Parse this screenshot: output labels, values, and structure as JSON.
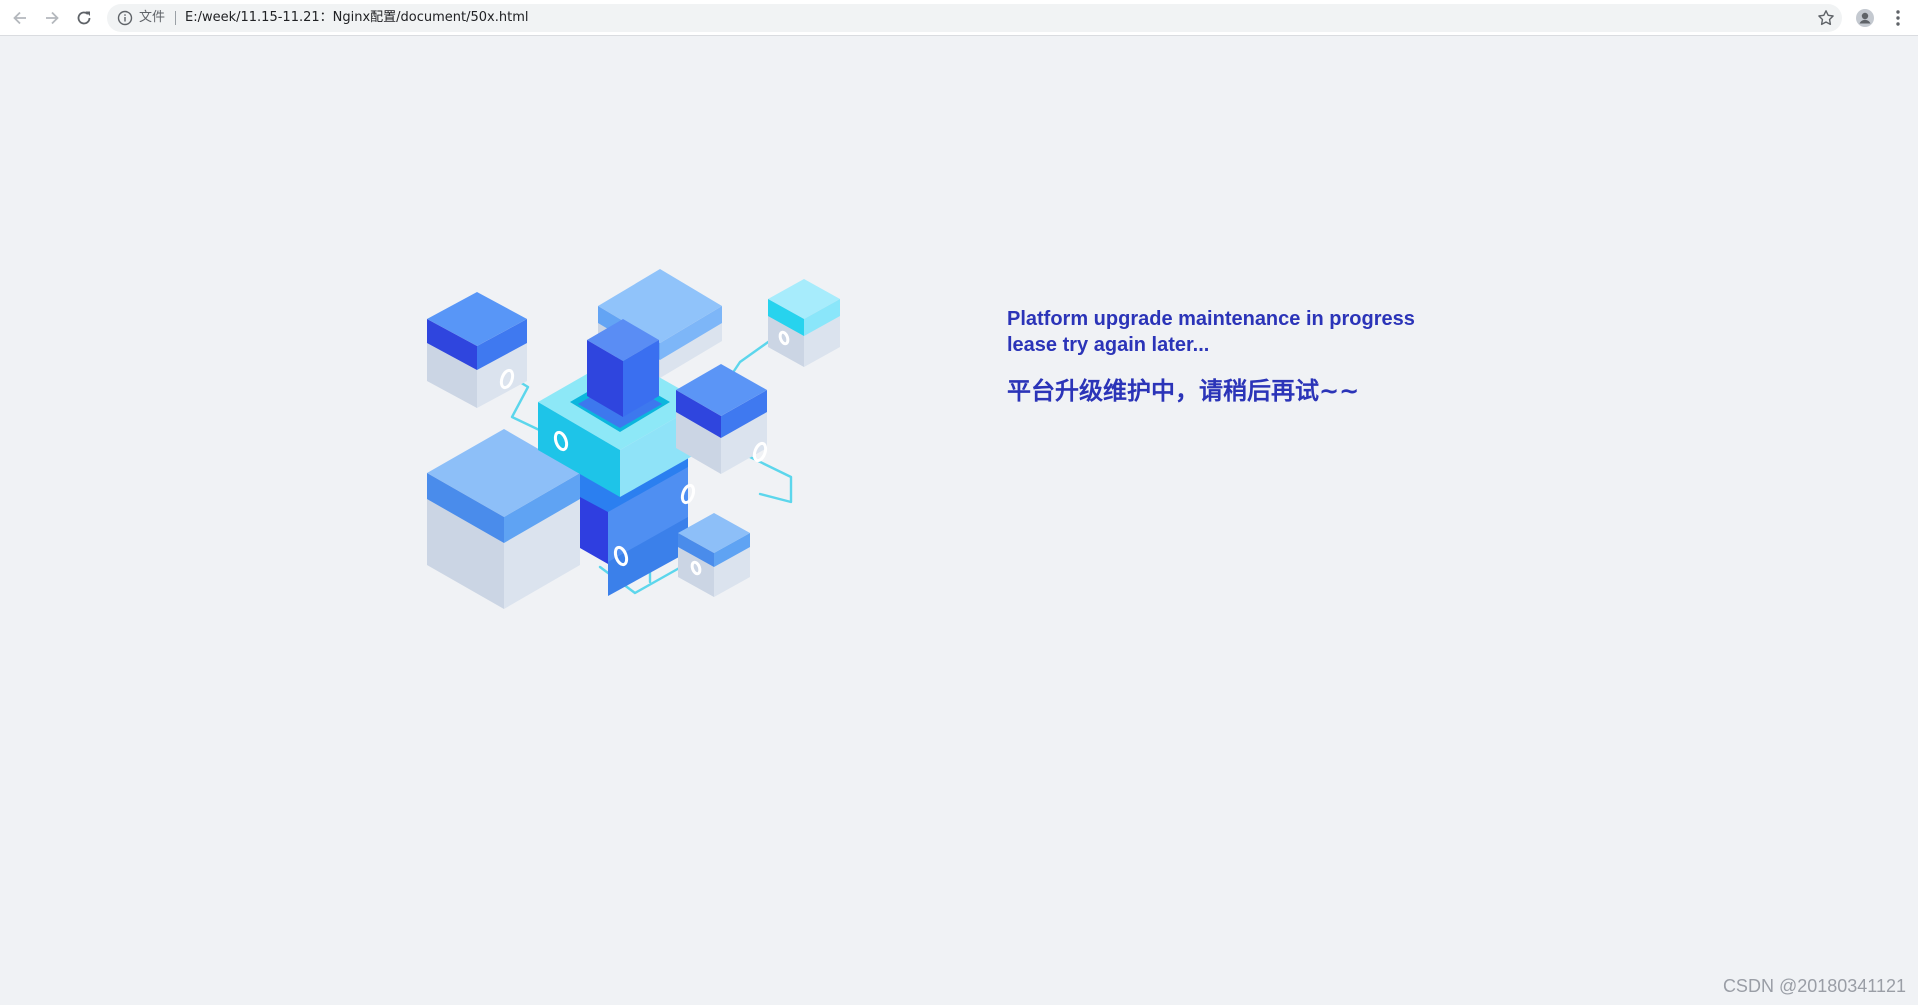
{
  "browser": {
    "chip_label": "文件",
    "url": "E:/week/11.15-11.21：Nginx配置/document/50x.html",
    "icons": {
      "back": "arrow-left-icon",
      "forward": "arrow-right-icon",
      "reload": "reload-icon",
      "info": "info-icon",
      "bookmark": "star-icon",
      "profile": "profile-icon",
      "menu": "kebab-menu-icon"
    }
  },
  "page": {
    "line1": "Platform upgrade maintenance in progress",
    "line2": "lease try again later...",
    "line3": "平台升级维护中，请稍后再试~~",
    "text_color": "#2b34b8",
    "background": "#f0f2f5"
  },
  "watermark": "CSDN @20180341121"
}
